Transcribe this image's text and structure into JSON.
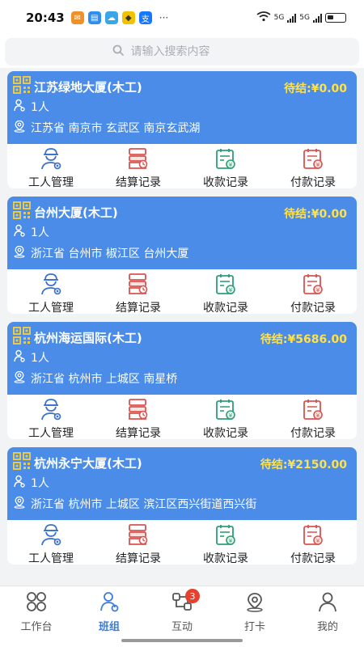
{
  "status_bar": {
    "time": "20:43",
    "dots": "···",
    "network": "5G",
    "network2": "5G"
  },
  "search": {
    "placeholder": "请输入搜索内容"
  },
  "projects": [
    {
      "title": "江苏绿地大厦(木工)",
      "pending": "待结:¥0.00",
      "workers": "1人",
      "address": "江苏省 南京市 玄武区 南京玄武湖"
    },
    {
      "title": "台州大厦(木工)",
      "pending": "待结:¥0.00",
      "workers": "1人",
      "address": "浙江省 台州市 椒江区 台州大厦"
    },
    {
      "title": "杭州海运国际(木工)",
      "pending": "待结:¥5686.00",
      "workers": "1人",
      "address": "浙江省 杭州市 上城区 南星桥"
    },
    {
      "title": "杭州永宁大厦(木工)",
      "pending": "待结:¥2150.00",
      "workers": "1人",
      "address": "浙江省 杭州市 上城区 滨江区西兴街道西兴街"
    }
  ],
  "actions": {
    "worker_mgmt": "工人管理",
    "settlement": "结算记录",
    "receipt": "收款记录",
    "payment": "付款记录"
  },
  "nav": {
    "workbench": "工作台",
    "team": "班组",
    "interact": "互动",
    "interact_badge": "3",
    "checkin": "打卡",
    "mine": "我的"
  },
  "colors": {
    "card_header": "#4a8ce8",
    "pending_text": "#ffe14a",
    "active_tab": "#3b7ddd",
    "icon_blue": "#3b6fd0",
    "icon_red": "#d9534f",
    "icon_green": "#2e9e77",
    "badge": "#e5412d"
  }
}
